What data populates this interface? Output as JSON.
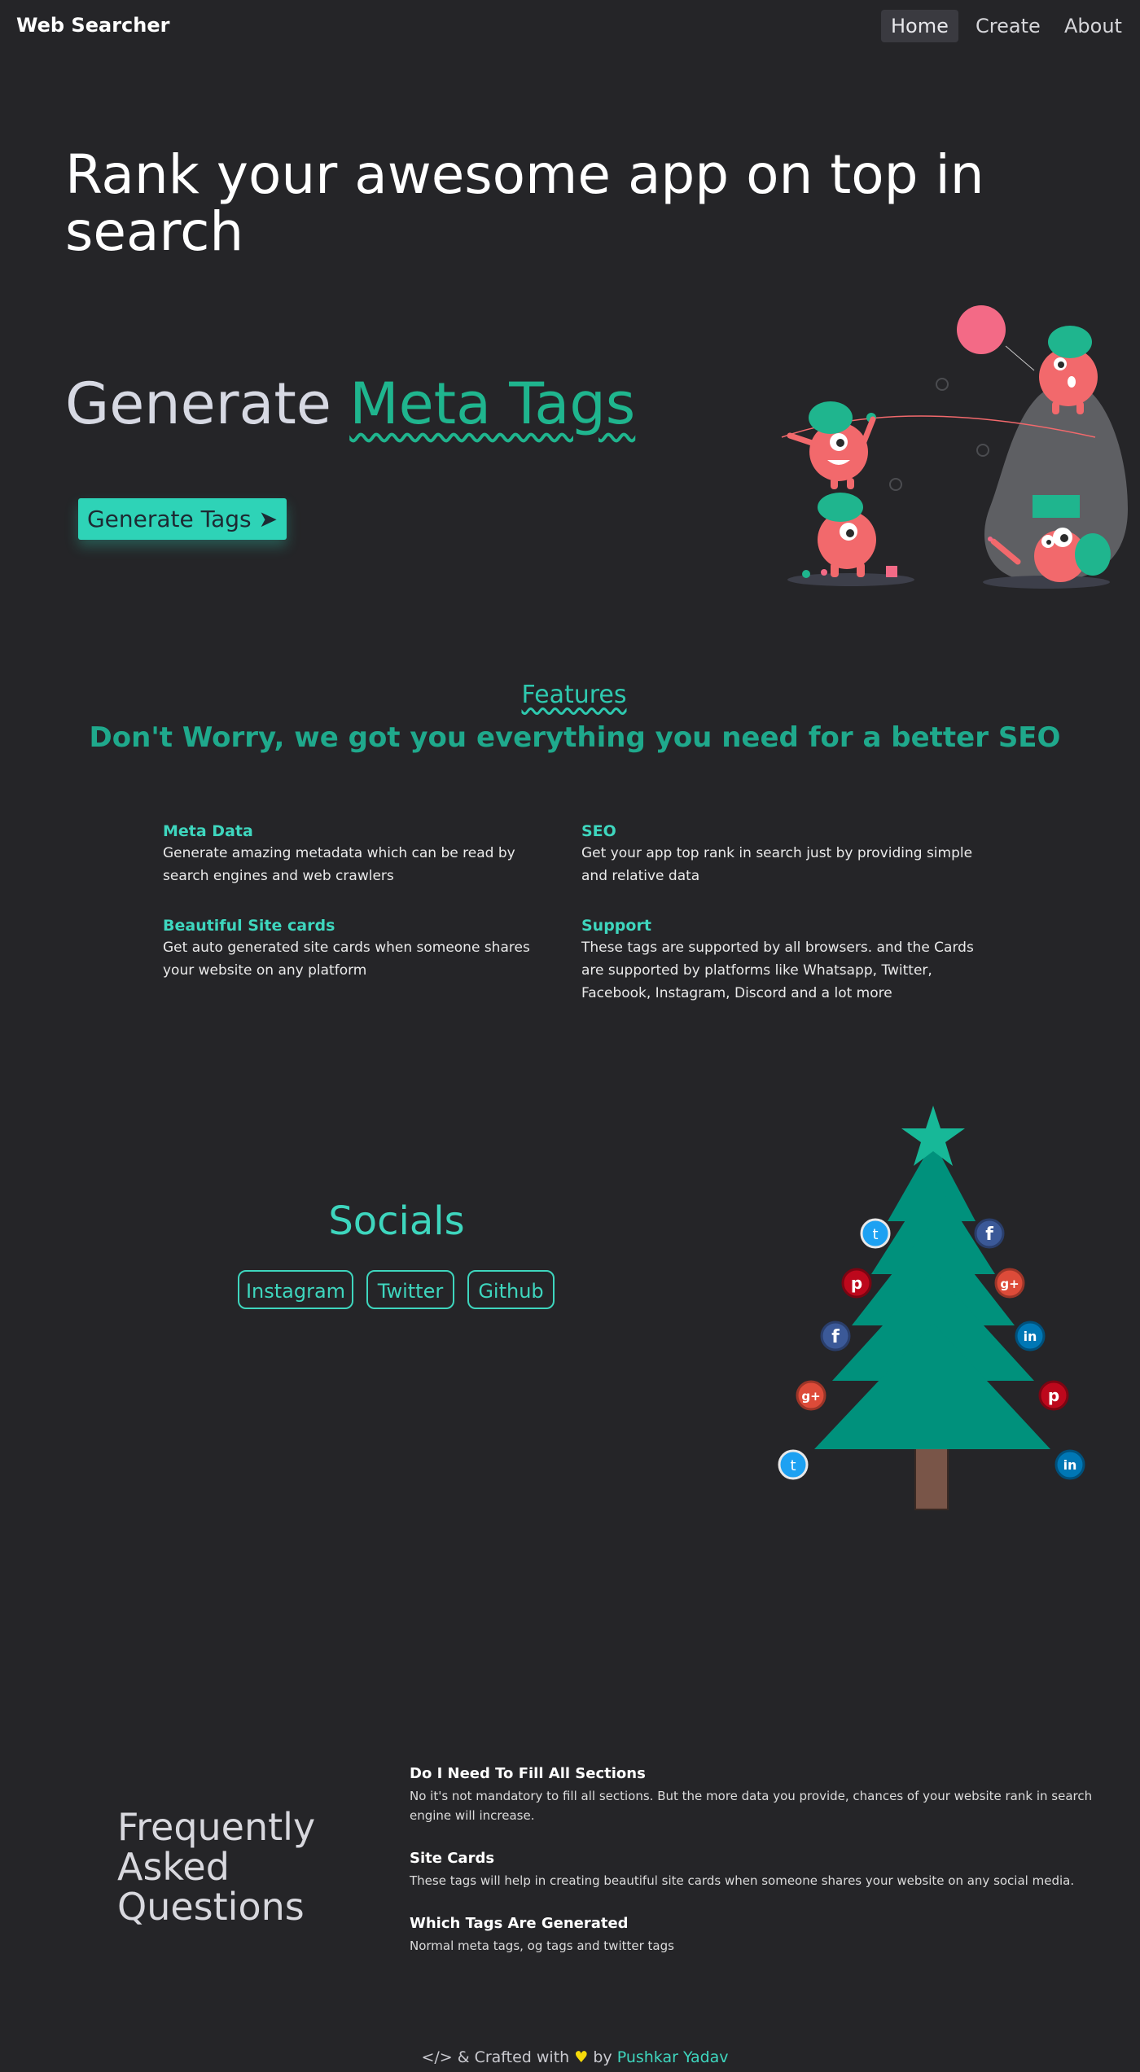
{
  "nav": {
    "brand": "Web Searcher",
    "items": [
      {
        "label": "Home"
      },
      {
        "label": "Create"
      },
      {
        "label": "About"
      }
    ]
  },
  "hero": {
    "title": "Rank your awesome app on top in search",
    "generate_prefix": "Generate",
    "generate_accent": "Meta Tags",
    "button_label": "Generate Tags ➤"
  },
  "features": {
    "kicker": "Features",
    "title": "Don't Worry, we got you everything you need for a better SEO",
    "items": [
      {
        "heading": "Meta Data",
        "text": "Generate amazing metadata which can be read by search engines and web crawlers"
      },
      {
        "heading": "SEO",
        "text": "Get your app top rank in search just by providing simple and relative data"
      },
      {
        "heading": "Beautiful Site cards",
        "text": "Get auto generated site cards when someone shares your website on any platform"
      },
      {
        "heading": "Support",
        "text": "These tags are supported by all browsers. and the Cards are supported by platforms like Whatsapp, Twitter, Facebook, Instagram, Discord and a lot more"
      }
    ]
  },
  "socials": {
    "title": "Socials",
    "links": [
      {
        "label": "Instagram"
      },
      {
        "label": "Twitter"
      },
      {
        "label": "Github"
      }
    ]
  },
  "faq": {
    "title_lines": [
      "Frequently",
      "Asked",
      "Questions"
    ],
    "items": [
      {
        "q": "Do I Need To Fill All Sections",
        "a": "No it's not mandatory to fill all sections. But the more data you provide, chances of your website rank in search engine will increase."
      },
      {
        "q": "Site Cards",
        "a": "These tags will help in creating beautiful site cards when someone shares your website on any social media."
      },
      {
        "q": "Which Tags Are Generated",
        "a": "Normal meta tags, og tags and twitter tags"
      }
    ]
  },
  "footer": {
    "prefix": "</> & Crafted with",
    "heart": "♥",
    "by": "by",
    "author": "Pushkar Yadav"
  },
  "tree_icons": {
    "twitter": "t",
    "facebook": "f",
    "pinterest": "p",
    "googleplus": "g+",
    "linkedin": "in"
  },
  "colors": {
    "background": "#252528",
    "accent": "#2ed3b7",
    "accent_dark": "#1fa98c",
    "monster": "#f2696c",
    "tree": "#00917c"
  }
}
